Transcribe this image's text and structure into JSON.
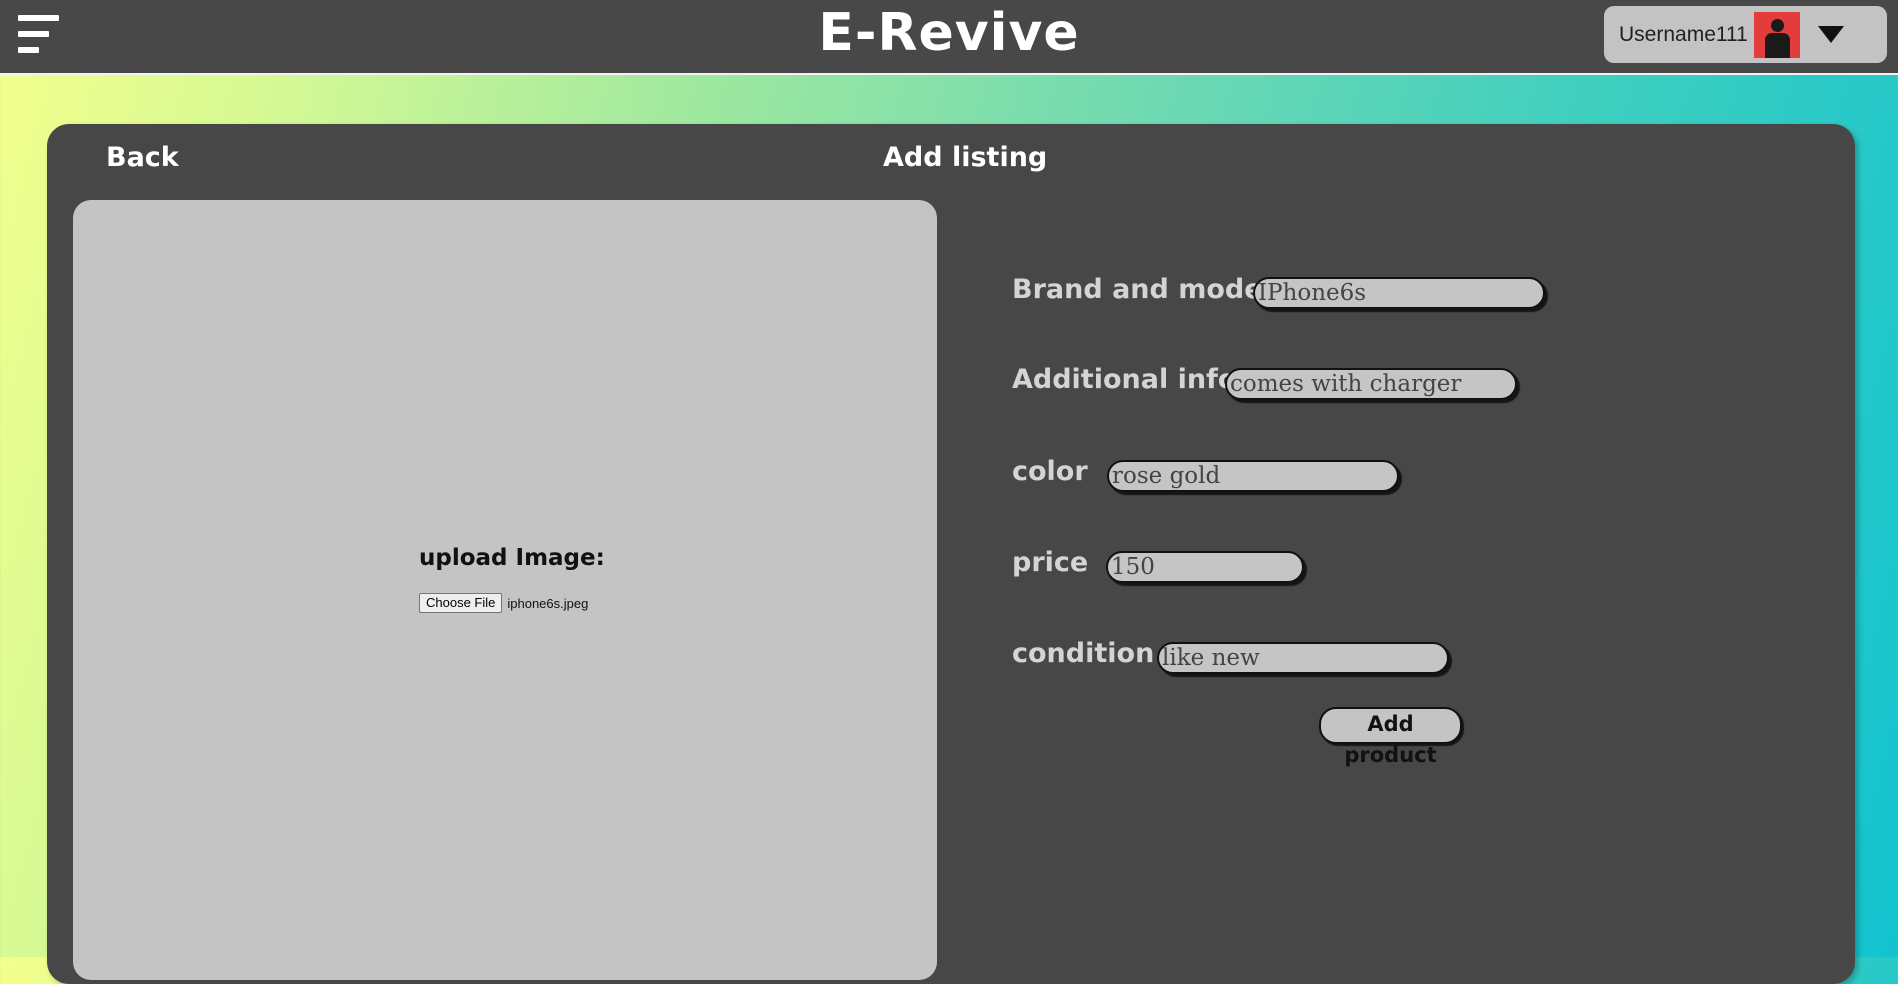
{
  "header": {
    "brand": "E-Revive",
    "username": "Username111",
    "menu_icon": "hamburger-menu-icon",
    "avatar_icon": "user-avatar-icon",
    "dropdown_icon": "caret-down-icon"
  },
  "page": {
    "back_label": "Back",
    "title": "Add listing"
  },
  "upload": {
    "label": "upload Image:",
    "button_label": "Choose File",
    "file_name": "iphone6s.jpeg"
  },
  "form": {
    "fields": [
      {
        "label": "Brand and model",
        "value": "IPhone6s"
      },
      {
        "label": "Additional info",
        "value": "comes with charger"
      },
      {
        "label": "color",
        "value": "rose gold"
      },
      {
        "label": "price",
        "value": "150"
      },
      {
        "label": "condition",
        "value": "like new"
      }
    ],
    "submit_label": "Add product"
  },
  "colors": {
    "topbar": "#484848",
    "panel": "#474747",
    "upload_area": "#c4c4c4",
    "input_bg": "#c5c5c5",
    "avatar": "#e23c3c"
  }
}
